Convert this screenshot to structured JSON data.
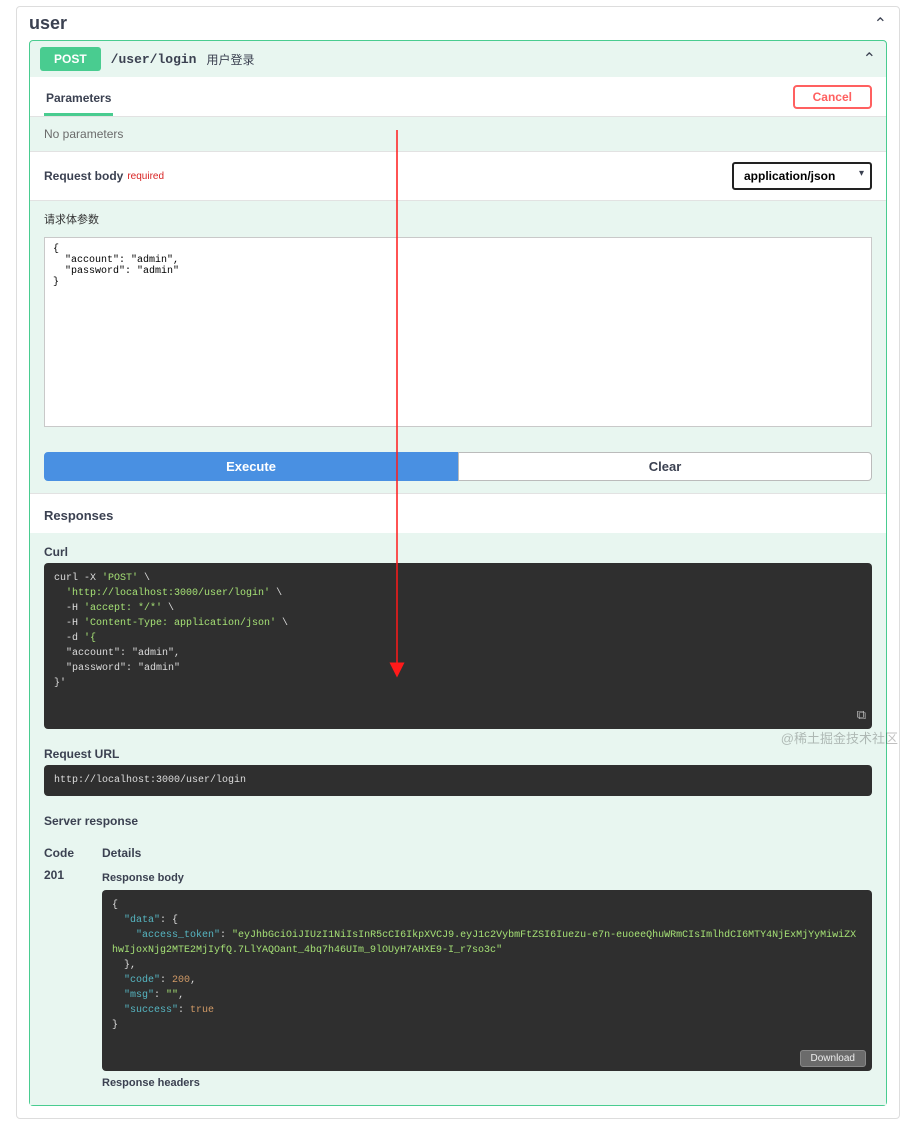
{
  "section": {
    "title": "user"
  },
  "op": {
    "method": "POST",
    "path": "/user/login",
    "summary": "用户登录"
  },
  "tabs": {
    "parameters": "Parameters",
    "cancel": "Cancel"
  },
  "params_msg": "No parameters",
  "reqbody": {
    "label": "Request body",
    "required": "required",
    "content_type": "application/json",
    "desc": "请求体参数",
    "value": "{\n  \"account\": \"admin\",\n  \"password\": \"admin\"\n}"
  },
  "buttons": {
    "execute": "Execute",
    "clear": "Clear"
  },
  "responses": {
    "label": "Responses",
    "curl_label": "Curl",
    "curl_lines": [
      {
        "p": "curl -X ",
        "g": "'POST'",
        "t": " \\"
      },
      {
        "p": "  ",
        "g": "'http://localhost:3000/user/login'",
        "t": " \\"
      },
      {
        "p": "  -H ",
        "g": "'accept: */*'",
        "t": " \\"
      },
      {
        "p": "  -H ",
        "g": "'Content-Type: application/json'",
        "t": " \\"
      },
      {
        "p": "  -d ",
        "g": "'{",
        "t": ""
      },
      {
        "p": "  \"account\": \"admin\",",
        "g": "",
        "t": ""
      },
      {
        "p": "  \"password\": \"admin\"",
        "g": "",
        "t": ""
      },
      {
        "p": "}'",
        "g": "",
        "t": ""
      }
    ],
    "req_url_label": "Request URL",
    "req_url": "http://localhost:3000/user/login",
    "server_response_label": "Server response",
    "code_col": "Code",
    "details_col": "Details",
    "code": "201",
    "body_label": "Response body",
    "body_json": {
      "pre": "{\n  ",
      "k_data": "\"data\"",
      "c1": ": {\n    ",
      "k_at": "\"access_token\"",
      "c2": ": ",
      "v_at": "\"eyJhbGciOiJIUzI1NiIsInR5cCI6IkpXVCJ9.eyJ1c2VybmFtZSI6Iuezu-e7n-euoeeQhuWRmCIsImlhdCI6MTY4NjExMjYyMiwiZXhwIjoxNjg2MTE2MjIyfQ.7LlYAQOant_4bq7h46UIm_9lOUyH7AHXE9-I_r7so3c\"",
      "c3": "\n  },\n  ",
      "k_code": "\"code\"",
      "c4": ": ",
      "v_code": "200",
      "c5": ",\n  ",
      "k_msg": "\"msg\"",
      "c6": ": ",
      "v_msg": "\"\"",
      "c7": ",\n  ",
      "k_suc": "\"success\"",
      "c8": ": ",
      "v_suc": "true",
      "c9": "\n}"
    },
    "download": "Download",
    "headers_label": "Response headers"
  },
  "watermark": "@稀土掘金技术社区"
}
